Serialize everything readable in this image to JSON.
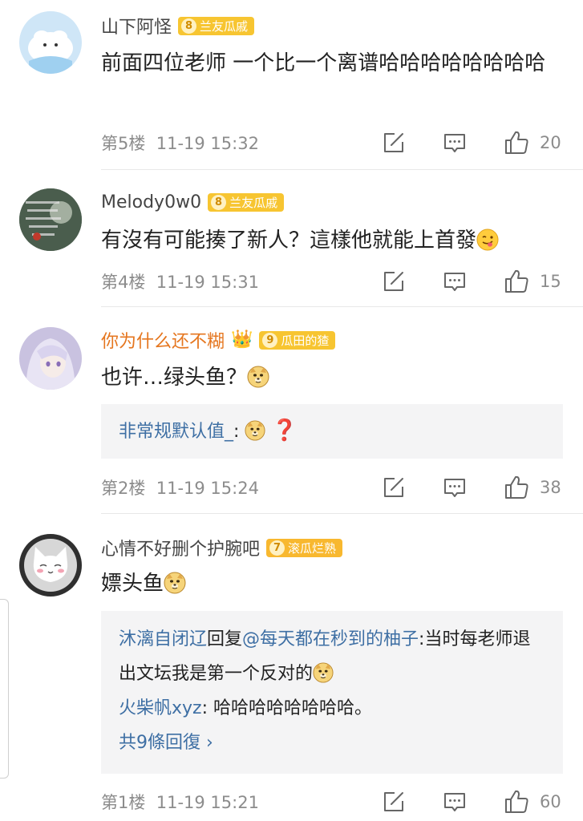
{
  "comments": [
    {
      "username": "山下阿怪",
      "badge_level": "8",
      "badge_label": "兰友瓜戚",
      "content": "前面四位老师 一个比一个离谱哈哈哈哈哈哈哈哈",
      "floor": "第5楼",
      "time": "11-19 15:32",
      "likes": "20"
    },
    {
      "username": "Melody0w0",
      "badge_level": "8",
      "badge_label": "兰友瓜戚",
      "content": "有沒有可能揍了新人？這樣他就能上首發",
      "floor": "第4楼",
      "time": "11-19 15:31",
      "likes": "15"
    },
    {
      "username": "你为什么还不糊",
      "badge_level": "9",
      "badge_label": "瓜田的猹",
      "content": "也许…绿头鱼？",
      "reply_user": "非常规默认值_",
      "reply_sep": ":",
      "floor": "第2楼",
      "time": "11-19 15:24",
      "likes": "38"
    },
    {
      "username": "心情不好删个护腕吧",
      "badge_level": "7",
      "badge_label": "滚瓜烂熟",
      "content": "嫖头鱼",
      "reply1_user": "沐漓自闭辽",
      "reply1_mid": "回复",
      "reply1_target": "@每天都在秒到的柚子",
      "reply1_text": ":当时每老师退出文坛我是第一个反对的",
      "reply2_user": "火柴帆xyz",
      "reply2_text": ": 哈哈哈哈哈哈哈哈。",
      "more_replies": "共9條回復 ›",
      "floor": "第1楼",
      "time": "11-19 15:21",
      "likes": "60"
    }
  ],
  "icons": {
    "reply": "edit-icon",
    "comment": "comment-icon",
    "like": "thumbs-up-icon",
    "emoji_dog": "doge-emoji",
    "emoji_tongue": "tongue-emoji",
    "emoji_question": "red-question-mark"
  },
  "colors": {
    "username": "#444444",
    "vip_username": "#e5761f",
    "badge": "#f7c531",
    "reply_link": "#3e6fa4",
    "meta_gray": "#8c8c8c"
  }
}
